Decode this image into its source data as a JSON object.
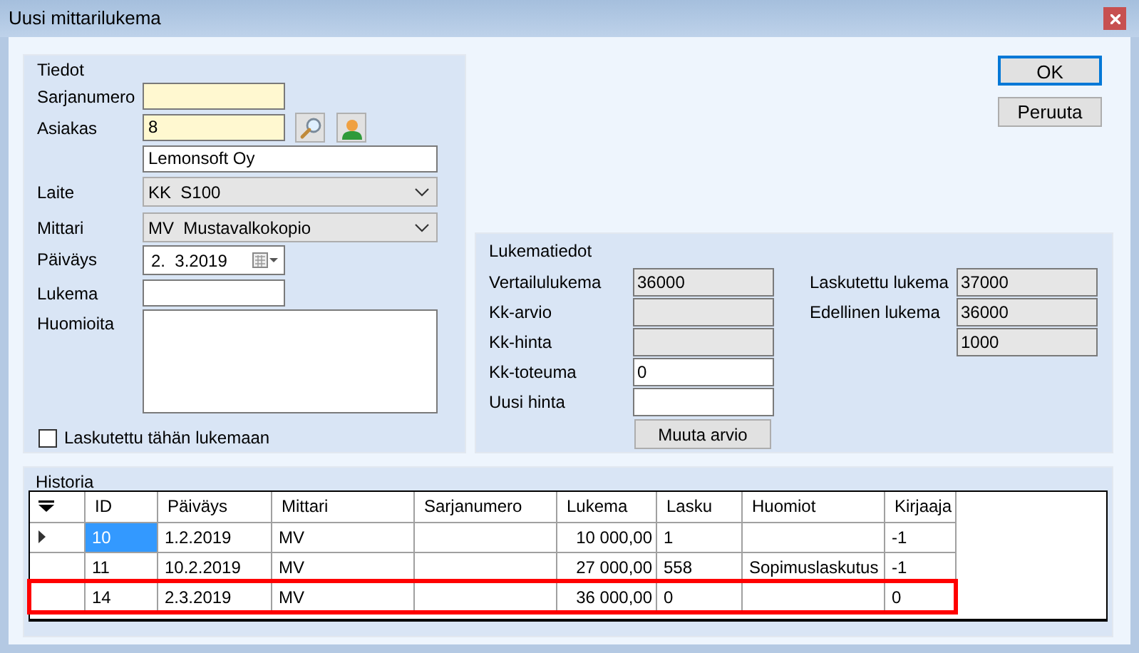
{
  "window": {
    "title": "Uusi mittarilukema"
  },
  "tiedot": {
    "title": "Tiedot",
    "fields": [
      {
        "kind": "input",
        "label": "Sarjanumero",
        "required": true
      },
      {
        "kind": "lookup",
        "label": "Asiakas",
        "value": "8",
        "required": true
      },
      {
        "kind": "input",
        "value": "Lemonsoft Oy",
        "required": false
      },
      {
        "kind": "combo",
        "label": "Laite",
        "value": "KK  S100"
      },
      {
        "kind": "combo",
        "label": "Mittari",
        "value": "MV  Mustavalkokopio"
      },
      {
        "kind": "date",
        "label": "Päiväys",
        "value": "2.  3.2019"
      },
      {
        "kind": "input",
        "label": "Lukema",
        "required": false
      },
      {
        "kind": "textarea",
        "label": "Huomioita"
      }
    ],
    "checkbox": {
      "label": "Laskutettu tähän lukemaan",
      "checked": false
    }
  },
  "buttons": [
    {
      "label": "OK",
      "default": true
    },
    {
      "label": "Peruuta",
      "default": false
    }
  ],
  "lukematiedot": {
    "title": "Lukematiedot",
    "left": [
      {
        "label": "Vertailulukema",
        "value": "36000",
        "readonly": true
      },
      {
        "label": "Kk-arvio",
        "readonly": true
      },
      {
        "label": "Kk-hinta",
        "readonly": true
      },
      {
        "label": "Kk-toteuma",
        "value": "0",
        "readonly": false
      },
      {
        "label": "Uusi hinta",
        "readonly": false
      }
    ],
    "right": [
      {
        "label": "Laskutettu lukema",
        "value": "37000",
        "readonly": true
      },
      {
        "label": "Edellinen lukema",
        "value": "36000",
        "readonly": true
      },
      {
        "value": "1000",
        "readonly": true
      }
    ],
    "button": "Muuta arvio"
  },
  "historia": {
    "title": "Historia",
    "columns": [
      {
        "label": "ID",
        "kind": "text"
      },
      {
        "label": "Päiväys",
        "kind": "text"
      },
      {
        "label": "Mittari",
        "kind": "text"
      },
      {
        "label": "Sarjanumero",
        "kind": "text"
      },
      {
        "label": "Lukema",
        "kind": "number"
      },
      {
        "label": "Lasku",
        "kind": "text"
      },
      {
        "label": "Huomiot",
        "kind": "text"
      },
      {
        "label": "Kirjaaja",
        "kind": "text"
      }
    ],
    "rows": [
      {
        "current": true,
        "selected": true,
        "marked": false,
        "cells": [
          "10",
          "1.2.2019",
          "MV",
          "",
          "10 000,00",
          "1",
          "",
          "-1"
        ]
      },
      {
        "current": false,
        "selected": false,
        "marked": false,
        "cells": [
          "11",
          "10.2.2019",
          "MV",
          "",
          "27 000,00",
          "558",
          "Sopimuslaskutus",
          "-1"
        ]
      },
      {
        "current": false,
        "selected": false,
        "marked": true,
        "cells": [
          "14",
          "2.3.2019",
          "MV",
          "",
          "36 000,00",
          "0",
          "",
          "0"
        ]
      }
    ]
  }
}
